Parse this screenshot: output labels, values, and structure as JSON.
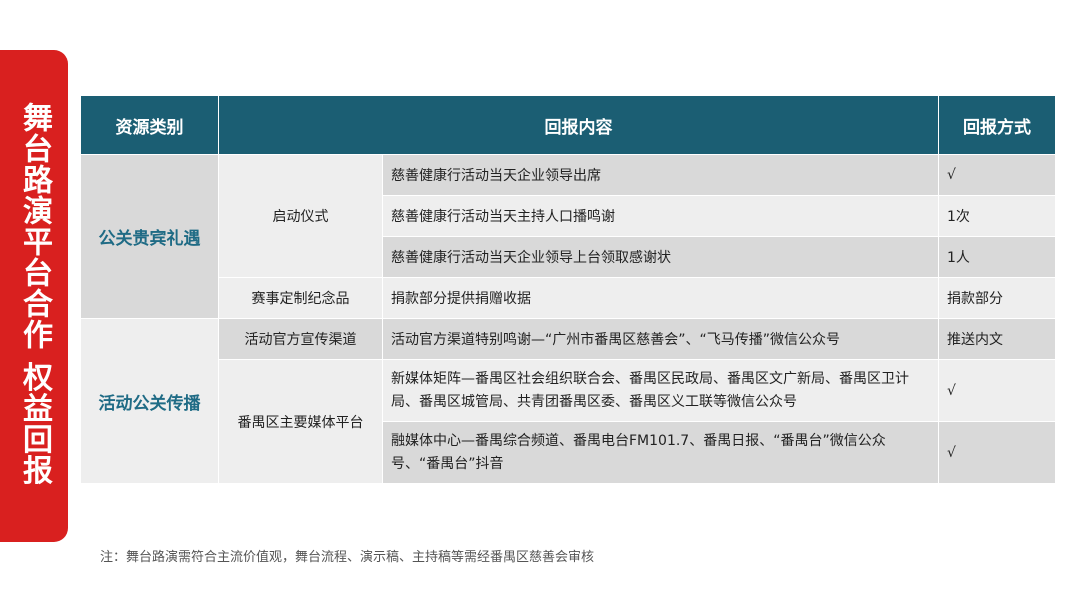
{
  "side_title": "舞台路演平台合作 权益回报",
  "table": {
    "headers": [
      "资源类别",
      "回报内容",
      "回报方式"
    ],
    "group1": {
      "category": "公关贵宾礼遇",
      "sub1": "启动仪式",
      "rows1": [
        {
          "content": "慈善健康行活动当天企业领导出席",
          "method": "√"
        },
        {
          "content": "慈善健康行活动当天主持人口播鸣谢",
          "method": "1次"
        },
        {
          "content": "慈善健康行活动当天企业领导上台领取感谢状",
          "method": "1人"
        }
      ],
      "sub2": "赛事定制纪念品",
      "row2": {
        "content": "捐款部分提供捐赠收据",
        "method": "捐款部分"
      }
    },
    "group2": {
      "category": "活动公关传播",
      "sub1": "活动官方宣传渠道",
      "row1": {
        "content": "活动官方渠道特别鸣谢—“广州市番禺区慈善会”、“飞马传播”微信公众号",
        "method": "推送内文"
      },
      "sub2": "番禺区主要媒体平台",
      "rows2": [
        {
          "content": "新媒体矩阵—番禺区社会组织联合会、番禺区民政局、番禺区文广新局、番禺区卫计局、番禺区城管局、共青团番禺区委、番禺区义工联等微信公众号",
          "method": "√"
        },
        {
          "content": "融媒体中心—番禺综合频道、番禺电台FM101.7、番禺日报、“番禺台”微信公众号、“番禺台”抖音",
          "method": "√"
        }
      ]
    }
  },
  "note": "注：舞台路演需符合主流价值观，舞台流程、演示稿、主持稿等需经番禺区慈善会审核"
}
